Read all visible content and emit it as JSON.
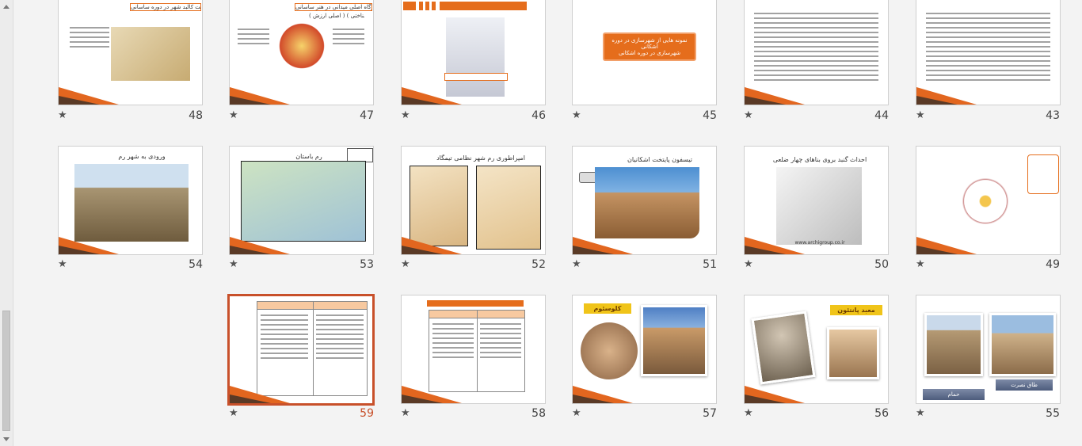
{
  "slides": [
    {
      "number": "48",
      "star": "★",
      "title": "ساخت کالبد شهر در دوره ساسانی"
    },
    {
      "number": "47",
      "star": "★",
      "title": "گزینه بعدی انتظامات از شهرگاه اصلی میدانی در هنر ساسانی",
      "subtitle": "( اصلی ارزش ) ( شناختی )"
    },
    {
      "number": "46",
      "star": "★",
      "title": ""
    },
    {
      "number": "45",
      "star": "★",
      "title": "نمونه هایی از شهرسازی در دوره اشکانی",
      "subtitle": "شهرسازی در دوره اشکانی"
    },
    {
      "number": "44",
      "star": "★",
      "title": ""
    },
    {
      "number": "43",
      "star": "★",
      "title": ""
    },
    {
      "number": "54",
      "star": "★",
      "title": "ورودی به شهر رم"
    },
    {
      "number": "53",
      "star": "★",
      "title": "رم باستان"
    },
    {
      "number": "52",
      "star": "★",
      "title": "امپراطوری رم شهر نظامی تیمگاد"
    },
    {
      "number": "51",
      "star": "★",
      "title": "تیسفون پایتخت اشکانیان"
    },
    {
      "number": "50",
      "star": "★",
      "title": "احداث گنبد بروی بناهای چهار ضلعی",
      "caption": "www.archigroup.co.ir"
    },
    {
      "number": "49",
      "star": "★",
      "title": ""
    },
    {
      "number": "59",
      "star": "★",
      "title": ""
    },
    {
      "number": "58",
      "star": "★",
      "title": ""
    },
    {
      "number": "57",
      "star": "★",
      "title": "کلوسئوم"
    },
    {
      "number": "56",
      "star": "★",
      "title": "معبد پانتئون"
    },
    {
      "number": "55",
      "star": "★",
      "title": "",
      "btn1": "حمام",
      "btn2": "طاق نصرت"
    }
  ]
}
